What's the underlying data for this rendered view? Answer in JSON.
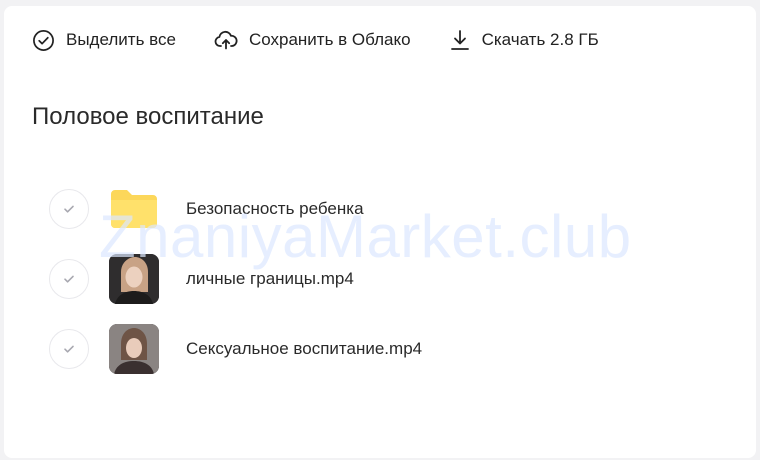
{
  "toolbar": {
    "select_all": "Выделить все",
    "save_to_cloud": "Сохранить в Облако",
    "download": "Скачать 2.8 ГБ"
  },
  "folder": {
    "title": "Половое воспитание"
  },
  "items": [
    {
      "name": "Безопасность ребенка",
      "kind": "folder",
      "icon": "folder-icon"
    },
    {
      "name": "личные границы.mp4",
      "kind": "video",
      "icon": "video-thumbnail"
    },
    {
      "name": "Сексуальное воспитание.mp4",
      "kind": "video",
      "icon": "video-thumbnail"
    }
  ],
  "watermark": "ZnaniyaMarket.club",
  "colors": {
    "folder_yellow": "#fcd75a",
    "check_gray": "#a8a8b0",
    "text": "#222222"
  }
}
